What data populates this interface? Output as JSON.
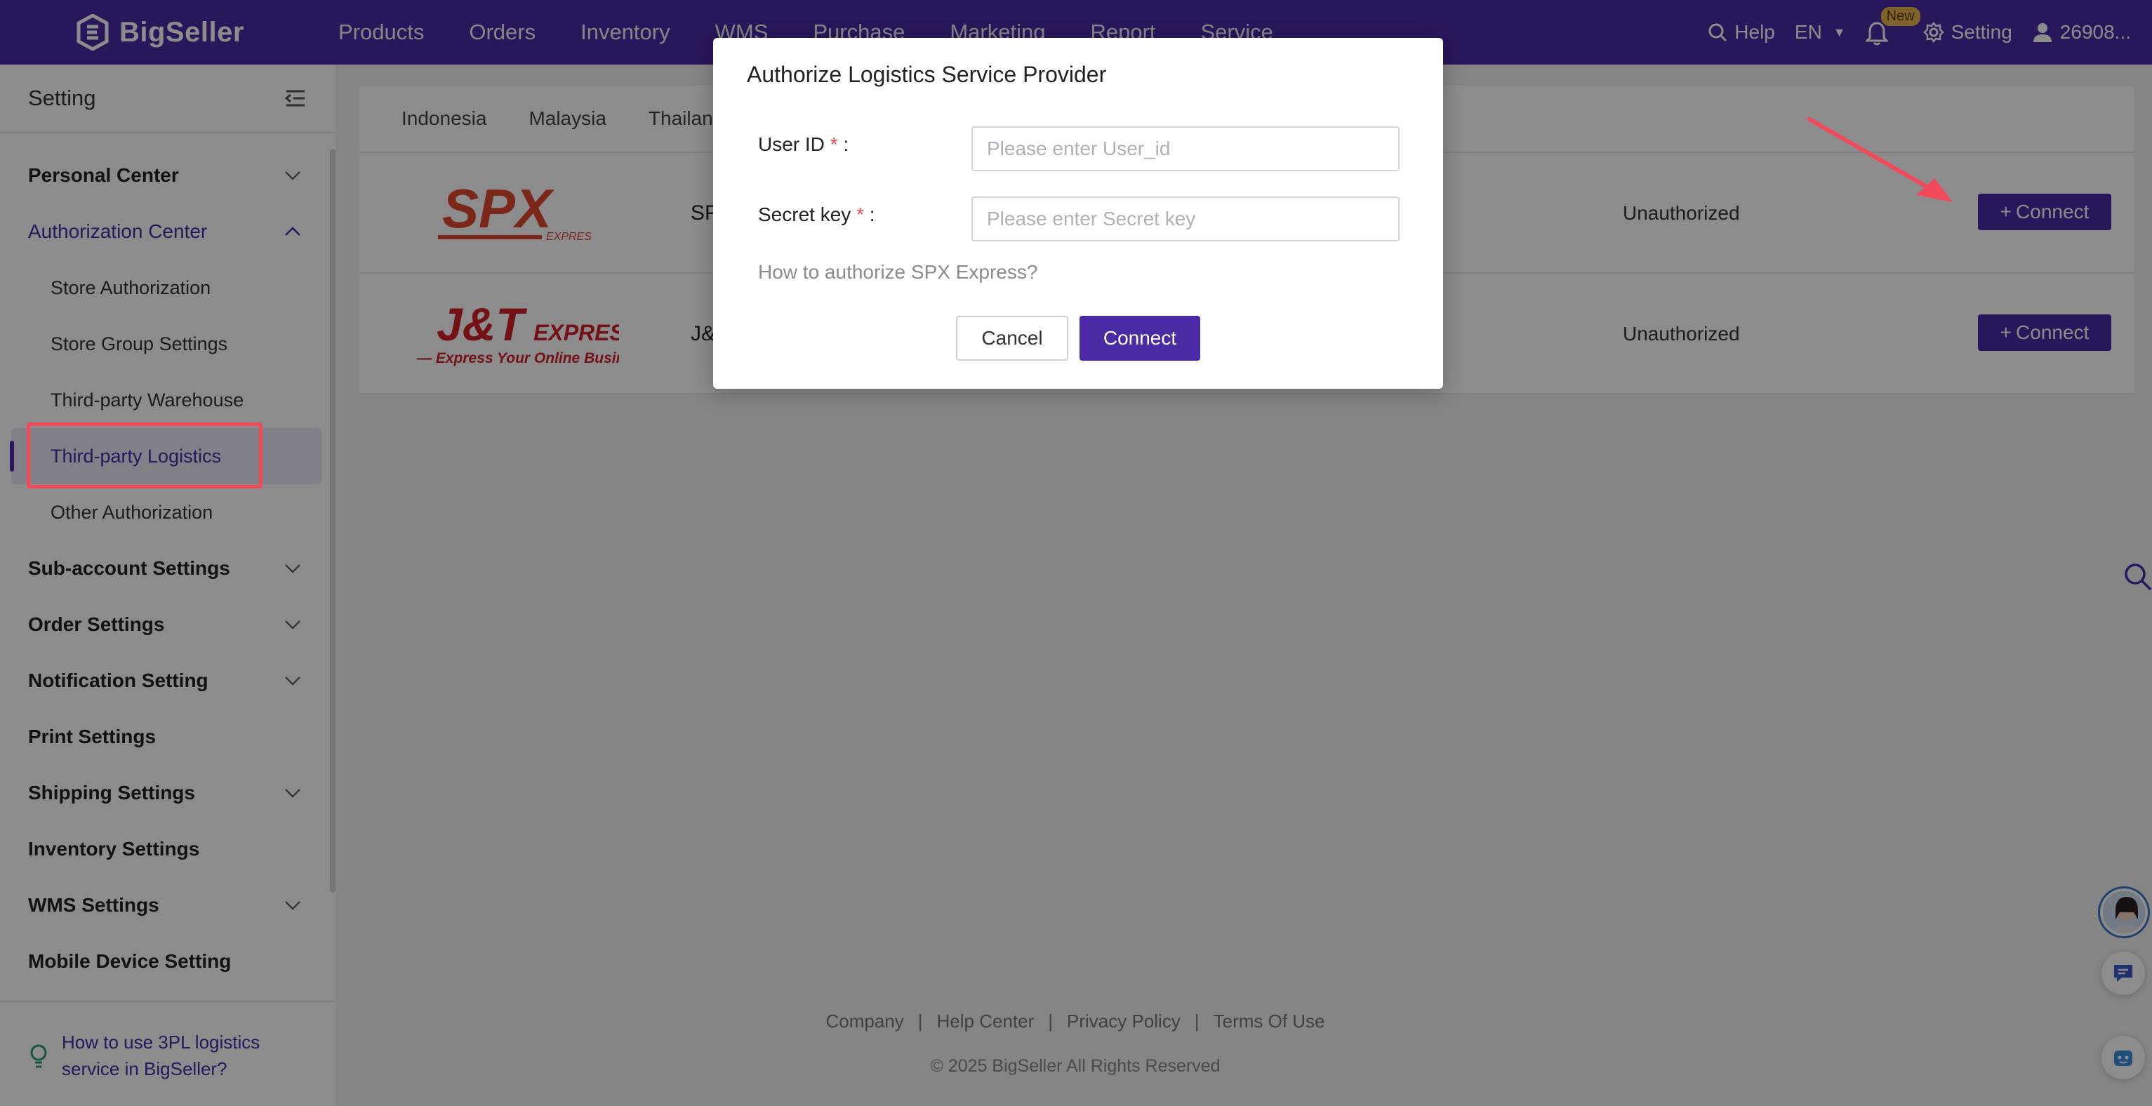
{
  "brand": {
    "name": "BigSeller"
  },
  "nav": {
    "items": [
      "Products",
      "Orders",
      "Inventory",
      "WMS",
      "Purchase",
      "Marketing",
      "Report",
      "Service"
    ]
  },
  "topright": {
    "help": "Help",
    "lang": "EN",
    "new_badge": "New",
    "setting": "Setting",
    "user": "26908..."
  },
  "sidebar": {
    "title": "Setting",
    "personal_center": "Personal Center",
    "authorization_center": "Authorization Center",
    "store_authorization": "Store Authorization",
    "store_group_settings": "Store Group Settings",
    "third_party_warehouse": "Third-party Warehouse",
    "third_party_logistics": "Third-party Logistics",
    "other_authorization": "Other Authorization",
    "sub_account_settings": "Sub-account Settings",
    "order_settings": "Order Settings",
    "notification_setting": "Notification Setting",
    "print_settings": "Print Settings",
    "shipping_settings": "Shipping Settings",
    "inventory_settings": "Inventory Settings",
    "wms_settings": "WMS Settings",
    "mobile_device_setting": "Mobile Device Setting",
    "footer_link": "How to use 3PL logistics service in BigSeller?"
  },
  "tabs": [
    "Indonesia",
    "Malaysia",
    "Thailan"
  ],
  "providers": [
    {
      "logo_text": "SPX",
      "logo_sub": "EXPRESS",
      "name": "SP",
      "status": "Unauthorized",
      "action": "Connect"
    },
    {
      "logo_text": "J&T",
      "logo_sub": "EXPRESS",
      "logo_tagline": "— Express Your Online Business —",
      "name": "J&",
      "status": "Unauthorized",
      "action": "Connect"
    }
  ],
  "footer": {
    "links": [
      "Company",
      "Help Center",
      "Privacy Policy",
      "Terms Of Use"
    ],
    "separator": "|",
    "copyright": "© 2025 BigSeller All Rights Reserved"
  },
  "modal": {
    "title": "Authorize Logistics Service Provider",
    "user_id_label": "User ID",
    "user_id_placeholder": "Please enter User_id",
    "secret_key_label": "Secret key",
    "secret_key_placeholder": "Please enter Secret key",
    "required_mark": "*",
    "colon": ":",
    "howto": "How to authorize SPX Express?",
    "cancel": "Cancel",
    "connect": "Connect"
  },
  "colors": {
    "brand": "#4b2aa6",
    "highlight": "#f24a5a",
    "spx": "#e0472f",
    "jt": "#d21f27"
  }
}
